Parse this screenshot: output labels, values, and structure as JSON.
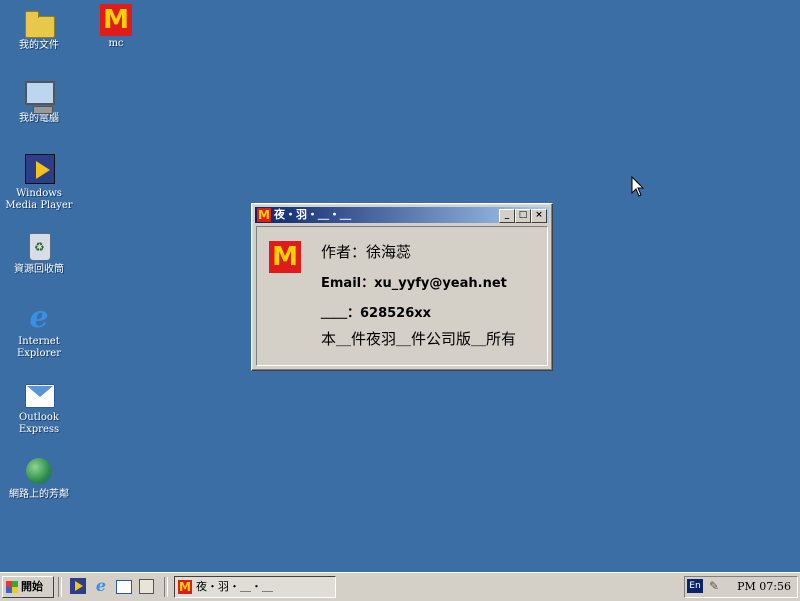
{
  "desktop": {
    "icons": [
      {
        "label": "我的文件",
        "icon": "folder-icon"
      },
      {
        "label": "mc",
        "icon": "mcdonalds-icon"
      },
      {
        "label": "我的電腦",
        "icon": "computer-icon"
      },
      {
        "label": "Windows Media Player",
        "icon": "media-player-icon"
      },
      {
        "label": "資源回收筒",
        "icon": "recycle-bin-icon"
      },
      {
        "label": "Internet Explorer",
        "icon": "internet-explorer-icon"
      },
      {
        "label": "Outlook Express",
        "icon": "outlook-express-icon"
      },
      {
        "label": "網路上的芳鄰",
        "icon": "network-icon"
      }
    ],
    "background_color": "#3a6ea5"
  },
  "dialog": {
    "title": "夜・羽・＿・＿",
    "logo_text": "M",
    "lines": {
      "author": "作者：徐海蕊",
      "email": "Email：xu_yyfy@yeah.net",
      "qq": "＿＿：628526xx",
      "copyright": "本＿件夜羽＿件公司版＿所有"
    },
    "controls": {
      "minimize": "_",
      "maximize": "□",
      "close": "×"
    }
  },
  "taskbar": {
    "start_label": "開始",
    "task_button_label": "夜・羽・＿・＿",
    "tray": {
      "language": "En",
      "clock": "PM 07:56"
    }
  }
}
